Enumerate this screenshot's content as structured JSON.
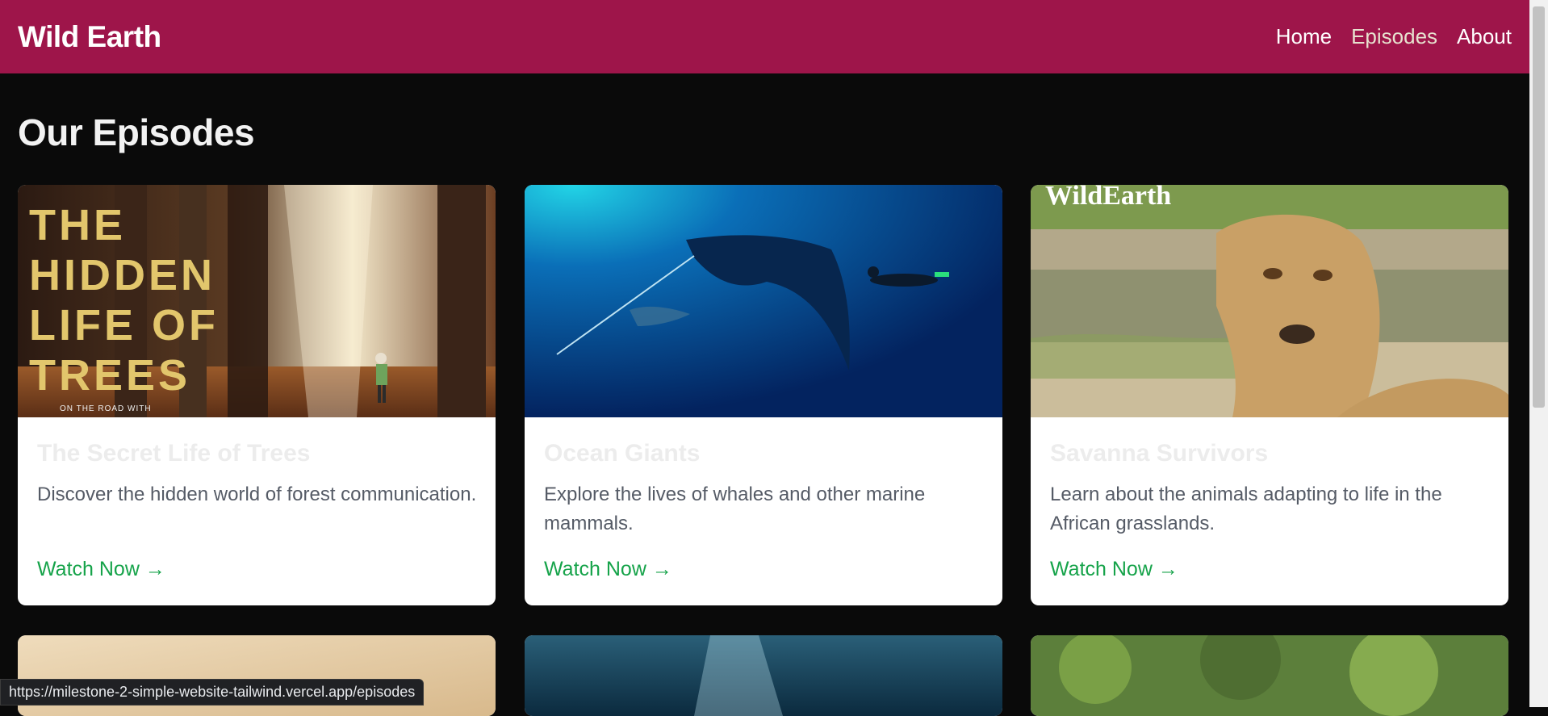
{
  "nav": {
    "brand": "Wild Earth",
    "links": [
      {
        "label": "Home",
        "active": false
      },
      {
        "label": "Episodes",
        "active": true
      },
      {
        "label": "About",
        "active": false
      }
    ]
  },
  "page": {
    "title": "Our Episodes"
  },
  "episodes": [
    {
      "image_text": [
        "THE",
        "HIDDEN",
        "LIFE OF",
        "TREES"
      ],
      "image_caption": "ON THE ROAD WITH",
      "title": "The Secret Life of Trees",
      "description": "Discover the hidden world of forest communication.",
      "cta": "Watch Now →"
    },
    {
      "title": "Ocean Giants",
      "description": "Explore the lives of whales and other marine mammals.",
      "cta": "Watch Now →"
    },
    {
      "image_text": "WildEarth",
      "title": "Savanna Survivors",
      "description": "Learn about the animals adapting to life in the African grasslands.",
      "cta": "Watch Now →"
    }
  ],
  "status_url": "https://milestone-2-simple-website-tailwind.vercel.app/episodes",
  "colors": {
    "navbar": "#9e154a",
    "background": "#0a0a0a",
    "link": "#16a34a"
  }
}
